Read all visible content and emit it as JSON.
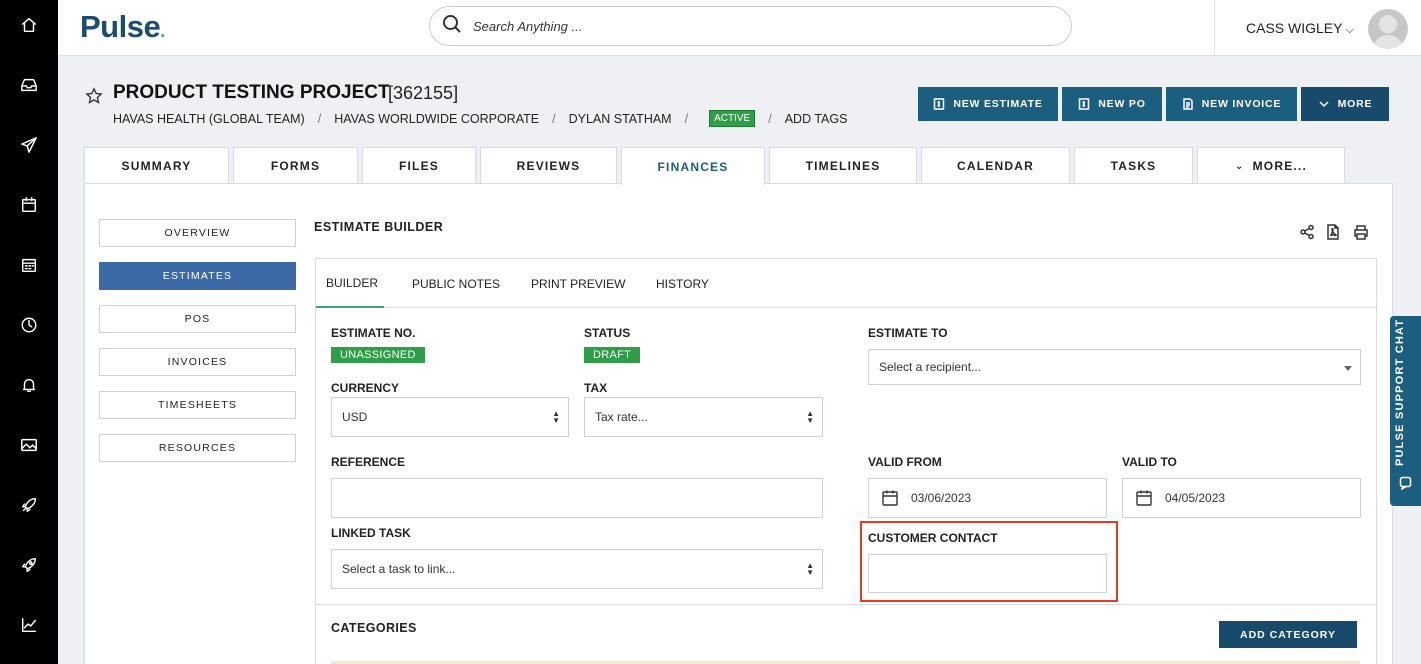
{
  "app": {
    "logo_text": "Pulse",
    "logo_dot": ".",
    "brand_color": "#1b4d6e",
    "accent_color": "#3aa776"
  },
  "rail": {
    "icons": [
      "home-icon",
      "inbox-icon",
      "send-icon",
      "calendar-icon",
      "schedule-icon",
      "clock-icon",
      "bell-icon",
      "image-icon",
      "rocket-icon",
      "rocket-alt-icon",
      "chart-icon"
    ]
  },
  "header": {
    "search_placeholder": "Search Anything ...",
    "user_name": "CASS WIGLEY",
    "user_chevron": "⌵"
  },
  "project": {
    "title": "PRODUCT TESTING PROJECT",
    "id": "[362155]",
    "crumbs": [
      "HAVAS HEALTH (GLOBAL TEAM)",
      "HAVAS WORLDWIDE CORPORATE",
      "DYLAN STATHAM"
    ],
    "separator": "/",
    "status_badge": "ACTIVE",
    "add_tags": "ADD TAGS"
  },
  "actions": {
    "new_estimate": "NEW ESTIMATE",
    "new_po": "NEW PO",
    "new_invoice": "NEW INVOICE",
    "more": "MORE"
  },
  "tabs": [
    "SUMMARY",
    "FORMS",
    "FILES",
    "REVIEWS",
    "FINANCES",
    "TIMELINES",
    "CALENDAR",
    "TASKS",
    "MORE..."
  ],
  "active_tab": "FINANCES",
  "side_nav": [
    "OVERVIEW",
    "ESTIMATES",
    "POS",
    "INVOICES",
    "TIMESHEETS",
    "RESOURCES"
  ],
  "active_side_nav": "ESTIMATES",
  "estimate_builder": {
    "title": "ESTIMATE BUILDER",
    "tool_icons": [
      "share-icon",
      "pdf-icon",
      "print-icon"
    ],
    "subtabs": [
      "BUILDER",
      "PUBLIC NOTES",
      "PRINT PREVIEW",
      "HISTORY"
    ],
    "active_subtab": "BUILDER",
    "estimate_no_label": "ESTIMATE NO.",
    "estimate_no_value": "UNASSIGNED",
    "status_label": "STATUS",
    "status_value": "DRAFT",
    "estimate_to_label": "ESTIMATE TO",
    "estimate_to_placeholder": "Select a recipient...",
    "currency_label": "CURRENCY",
    "currency_value": "USD",
    "tax_label": "TAX",
    "tax_placeholder": "Tax rate...",
    "reference_label": "REFERENCE",
    "reference_value": "",
    "valid_from_label": "VALID FROM",
    "valid_from_value": "03/06/2023",
    "valid_to_label": "VALID TO",
    "valid_to_value": "04/05/2023",
    "linked_task_label": "LINKED TASK",
    "linked_task_placeholder": "Select a task to link...",
    "customer_contact_label": "CUSTOMER CONTACT",
    "customer_contact_value": "",
    "categories_label": "CATEGORIES",
    "add_category": "ADD CATEGORY"
  },
  "support_chat": {
    "label": "PULSE SUPPORT CHAT"
  }
}
